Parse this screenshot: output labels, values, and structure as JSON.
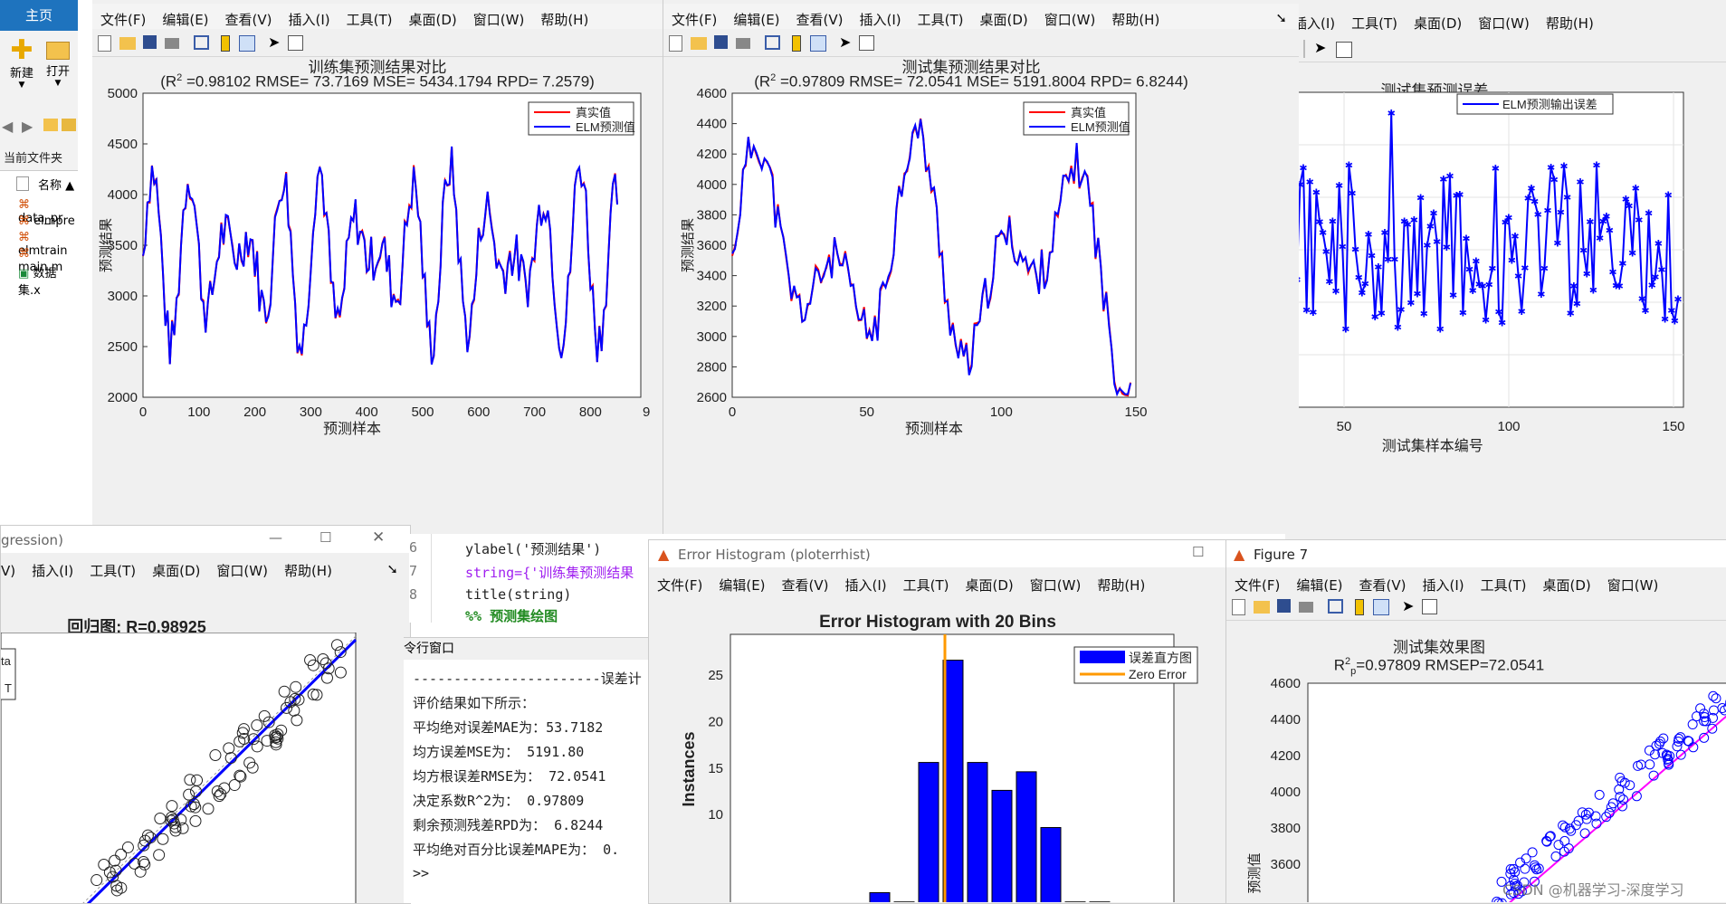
{
  "matlab": {
    "home_tab": "主页",
    "new_label": "新建",
    "open_label": "打开",
    "current_folder": "当前文件夹",
    "name_col": "名称 ▲",
    "files": [
      "data_pr",
      "elmpre",
      "elmtrain",
      "main.m",
      "数据集.x"
    ]
  },
  "menus": [
    "文件(F)",
    "编辑(E)",
    "查看(V)",
    "插入(I)",
    "工具(T)",
    "桌面(D)",
    "窗口(W)",
    "帮助(H)"
  ],
  "fig_train": {
    "title": "训练集预测结果对比",
    "subtitle_pre": "(R",
    "sup": "2",
    "subtitle_post": " =0.98102 RMSE= 73.7169 MSE= 5434.1794 RPD= 7.2579)",
    "legend": [
      "真实值",
      "ELM预测值"
    ],
    "ylabel": "预测结果",
    "xlabel": "预测样本",
    "yticks": [
      "5000",
      "4500",
      "4000",
      "3500",
      "3000",
      "2500",
      "2000"
    ],
    "xticks": [
      "0",
      "100",
      "200",
      "300",
      "400",
      "500",
      "600",
      "700",
      "800",
      "9"
    ]
  },
  "fig_test": {
    "title": "测试集预测结果对比",
    "subtitle_pre": "(R",
    "sup": "2",
    "subtitle_post": " =0.97809 RMSE= 72.0541 MSE= 5191.8004 RPD= 6.8244)",
    "legend": [
      "真实值",
      "ELM预测值"
    ],
    "ylabel": "预测结果",
    "xlabel": "预测样本",
    "yticks": [
      "4600",
      "4400",
      "4200",
      "4000",
      "3800",
      "3600",
      "3400",
      "3200",
      "3000",
      "2800",
      "2600"
    ],
    "xticks": [
      "0",
      "50",
      "100",
      "150"
    ]
  },
  "fig_err": {
    "menus": [
      "插入(I)",
      "工具(T)",
      "桌面(D)",
      "窗口(W)",
      "帮助(H)"
    ],
    "title": "测试集预测误差",
    "legend": "ELM预测输出误差",
    "xlabel": "测试集样本编号",
    "xticks": [
      "50",
      "100",
      "150"
    ]
  },
  "fig_reg": {
    "win_title": "gression)",
    "menus": [
      "V)",
      "插入(I)",
      "工具(T)",
      "桌面(D)",
      "窗口(W)",
      "帮助(H)"
    ],
    "title": "回归图: R=0.98925",
    "legend_a": "ta",
    "legend_b": "T"
  },
  "editor": {
    "line_nums": [
      "6",
      "7",
      "8"
    ],
    "lines": [
      "ylabel('预测结果')",
      "string={'训练集预测结果",
      "title(string)",
      "%% 预测集绘图"
    ]
  },
  "cmdwin": {
    "title": "令行窗口",
    "header": "-----------------------误差计",
    "lines": [
      "评价结果如下所示：",
      "平均绝对误差MAE为：53.7182",
      "均方误差MSE为：       5191.80",
      "均方根误差RMSE为：    72.0541",
      "决定系数R^2为：   0.97809",
      "剩余预测残差RPD为：   6.8244",
      "平均绝对百分比误差MAPE为：  0."
    ],
    "prompt": ">>"
  },
  "fig_hist": {
    "win_title": "Error Histogram (ploterrhist)",
    "title": "Error Histogram with 20 Bins",
    "ylabel": "Instances",
    "legend": [
      "误差直方图",
      "Zero Error"
    ],
    "yticks": [
      "25",
      "20",
      "15",
      "10"
    ]
  },
  "fig7": {
    "win_title": "Figure 7",
    "title": "测试集效果图",
    "sub_pre": "R",
    "sub_sup": "2",
    "sub_sub": "p",
    "sub_post": "=0.97809  RMSEP=72.0541",
    "ylabel": "预测值",
    "yticks": [
      "4600",
      "4400",
      "4200",
      "4000",
      "3800",
      "3600"
    ]
  },
  "watermark": "CSDN @机器学习-深度学习",
  "colors": {
    "blue": "#0000ff",
    "red": "#ff0000",
    "orange": "#ff9900",
    "magenta": "#ff00ff"
  }
}
